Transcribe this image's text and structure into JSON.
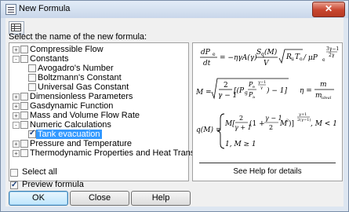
{
  "window": {
    "title": "New Formula",
    "close_label": "✕"
  },
  "toolbar": {
    "button_icon": "grid-icon"
  },
  "select_label": "Select the name of the new formula:",
  "tree": [
    {
      "label": "Compressible Flow",
      "level": 0,
      "expander": "+",
      "checked": false
    },
    {
      "label": "Constants",
      "level": 0,
      "expander": "-",
      "checked": false
    },
    {
      "label": "Avogadro's Number",
      "level": 1,
      "expander": "",
      "checked": false
    },
    {
      "label": "Boltzmann's Constant",
      "level": 1,
      "expander": "",
      "checked": false
    },
    {
      "label": "Universal Gas Constant",
      "level": 1,
      "expander": "",
      "checked": false
    },
    {
      "label": "Dimensionless Parameters",
      "level": 0,
      "expander": "+",
      "checked": false
    },
    {
      "label": "Gasdynamic Function",
      "level": 0,
      "expander": "+",
      "checked": false
    },
    {
      "label": "Mass and Volume Flow Rate",
      "level": 0,
      "expander": "+",
      "checked": false
    },
    {
      "label": "Numeric Calculations",
      "level": 0,
      "expander": "-",
      "checked": false
    },
    {
      "label": "Tank evacuation",
      "level": 1,
      "expander": "",
      "checked": true,
      "selected": true
    },
    {
      "label": "Pressure and Temperature",
      "level": 0,
      "expander": "+",
      "checked": false
    },
    {
      "label": "Thermodynamic Properties and Heat Transfer",
      "level": 0,
      "expander": "+",
      "checked": false
    }
  ],
  "preview": {
    "help_text": "See Help for details",
    "eq1": {
      "dp": "dP",
      "dp_sub": "e",
      "dt": "dt",
      "rhs": "= −ηγA(γ)",
      "sq": "S",
      "sq_sub": "q",
      "m": "(M)",
      "v": "V",
      "rt": "R",
      "rt_sub": "u",
      "t": "T",
      "t_sub": "o",
      "mu": "/ μP",
      "mu_sub": "e",
      "exp_num": "3γ−1",
      "exp_den": "2γ"
    },
    "eq2": {
      "lhs": "M =",
      "num": "2",
      "den": "γ − 1",
      "paren": "[(P",
      "paren_sub": "g",
      "frac_num": "P",
      "frac_num_sub": "e",
      "frac_den": "P",
      "frac_den_sub": "a",
      "exp_num": "γ−1",
      "exp_den": "γ",
      "tail": ") − 1]",
      "eta_lhs": "η =",
      "eta_num": "m",
      "eta_den": "m",
      "eta_den_sub": "ideal"
    },
    "eq3": {
      "lhs": "q(M) =",
      "case1_a": "M[",
      "case1_num": "2",
      "case1_den": "γ + 1",
      "case1_b": "(1 +",
      "case1_c_num": "γ − 1",
      "case1_c_den": "2",
      "case1_d": "M",
      "case1_d_sup": "2",
      "case1_e": ")]",
      "case1_exp_num": "γ+1",
      "case1_exp_den": "2(γ−1)",
      "case1_cond": ", M < 1",
      "case2": "1, M ≥ 1"
    }
  },
  "options": {
    "select_all": "Select all",
    "select_all_checked": false,
    "preview": "Preview formula",
    "preview_checked": true
  },
  "buttons": {
    "ok": "OK",
    "close": "Close",
    "help": "Help"
  }
}
